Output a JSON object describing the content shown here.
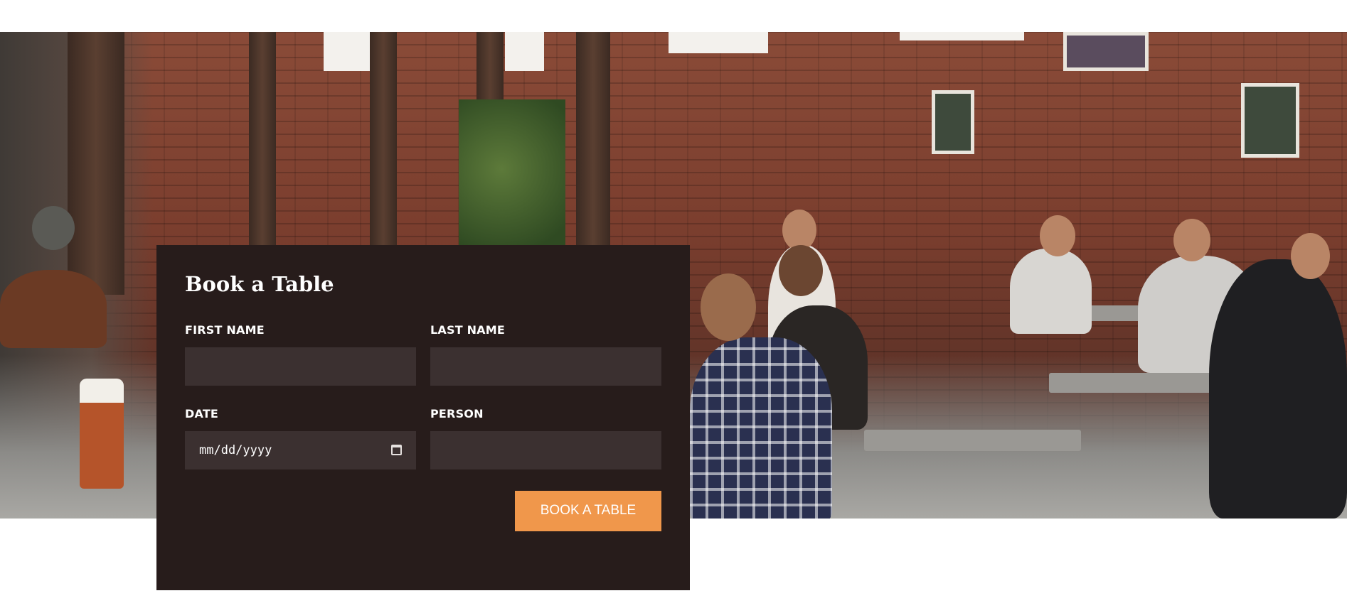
{
  "hero": {
    "image_alt": "Cafe interior with people seated at tables in front of a brick wall"
  },
  "booking": {
    "title": "Book a Table",
    "fields": {
      "first_name": {
        "label": "FIRST NAME",
        "value": ""
      },
      "last_name": {
        "label": "LAST NAME",
        "value": ""
      },
      "date": {
        "label": "DATE",
        "value": "mm/dd/yyyy"
      },
      "person": {
        "label": "PERSON",
        "value": ""
      }
    },
    "submit_label": "BOOK A TABLE"
  },
  "colors": {
    "card_background": "#271c1b",
    "input_background": "#3b3030",
    "accent": "#f0974b",
    "text": "#ffffff"
  }
}
